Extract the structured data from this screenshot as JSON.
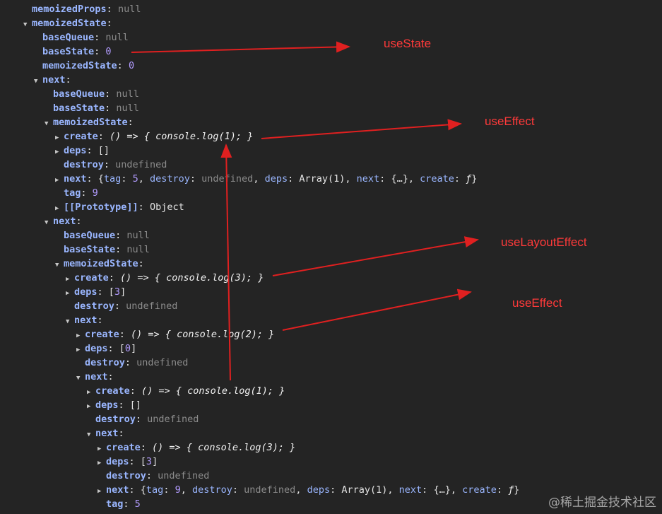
{
  "rows": [
    {
      "indent": 0,
      "arrow": "",
      "key": "memoizedProps",
      "val": "null",
      "vt": "null"
    },
    {
      "indent": 0,
      "arrow": "down",
      "key": "memoizedState",
      "val": "",
      "vt": ""
    },
    {
      "indent": 1,
      "arrow": "",
      "key": "baseQueue",
      "val": "null",
      "vt": "null"
    },
    {
      "indent": 1,
      "arrow": "",
      "key": "baseState",
      "val": "0",
      "vt": "num"
    },
    {
      "indent": 1,
      "arrow": "",
      "key": "memoizedState",
      "val": "0",
      "vt": "num"
    },
    {
      "indent": 1,
      "arrow": "down",
      "key": "next",
      "val": "",
      "vt": ""
    },
    {
      "indent": 2,
      "arrow": "",
      "key": "baseQueue",
      "val": "null",
      "vt": "null"
    },
    {
      "indent": 2,
      "arrow": "",
      "key": "baseState",
      "val": "null",
      "vt": "null"
    },
    {
      "indent": 2,
      "arrow": "down",
      "key": "memoizedState",
      "val": "",
      "vt": ""
    },
    {
      "indent": 3,
      "arrow": "right",
      "key": "create",
      "val": "() => { console.log(1); }",
      "vt": "fn"
    },
    {
      "indent": 3,
      "arrow": "right",
      "key": "deps",
      "val": "[]",
      "vt": "str"
    },
    {
      "indent": 3,
      "arrow": "",
      "key": "destroy",
      "val": "undefined",
      "vt": "null"
    },
    {
      "indent": 3,
      "arrow": "right",
      "key": "next",
      "val": "",
      "vt": "obj1"
    },
    {
      "indent": 3,
      "arrow": "",
      "key": "tag",
      "val": "9",
      "vt": "num"
    },
    {
      "indent": 3,
      "arrow": "right",
      "key": "[[Prototype]]",
      "val": "Object",
      "vt": "str"
    },
    {
      "indent": 2,
      "arrow": "down",
      "key": "next",
      "val": "",
      "vt": ""
    },
    {
      "indent": 3,
      "arrow": "",
      "key": "baseQueue",
      "val": "null",
      "vt": "null"
    },
    {
      "indent": 3,
      "arrow": "",
      "key": "baseState",
      "val": "null",
      "vt": "null"
    },
    {
      "indent": 3,
      "arrow": "down",
      "key": "memoizedState",
      "val": "",
      "vt": ""
    },
    {
      "indent": 4,
      "arrow": "right",
      "key": "create",
      "val": "() => { console.log(3); }",
      "vt": "fn"
    },
    {
      "indent": 4,
      "arrow": "right",
      "key": "deps",
      "val": "[3]",
      "vt": "arr3"
    },
    {
      "indent": 4,
      "arrow": "",
      "key": "destroy",
      "val": "undefined",
      "vt": "null"
    },
    {
      "indent": 4,
      "arrow": "down",
      "key": "next",
      "val": "",
      "vt": ""
    },
    {
      "indent": 5,
      "arrow": "right",
      "key": "create",
      "val": "() => { console.log(2); }",
      "vt": "fn"
    },
    {
      "indent": 5,
      "arrow": "right",
      "key": "deps",
      "val": "[0]",
      "vt": "arr0"
    },
    {
      "indent": 5,
      "arrow": "",
      "key": "destroy",
      "val": "undefined",
      "vt": "null"
    },
    {
      "indent": 5,
      "arrow": "down",
      "key": "next",
      "val": "",
      "vt": ""
    },
    {
      "indent": 6,
      "arrow": "right",
      "key": "create",
      "val": "() => { console.log(1); }",
      "vt": "fn"
    },
    {
      "indent": 6,
      "arrow": "right",
      "key": "deps",
      "val": "[]",
      "vt": "str"
    },
    {
      "indent": 6,
      "arrow": "",
      "key": "destroy",
      "val": "undefined",
      "vt": "null"
    },
    {
      "indent": 6,
      "arrow": "down",
      "key": "next",
      "val": "",
      "vt": ""
    },
    {
      "indent": 7,
      "arrow": "right",
      "key": "create",
      "val": "() => { console.log(3); }",
      "vt": "fn"
    },
    {
      "indent": 7,
      "arrow": "right",
      "key": "deps",
      "val": "[3]",
      "vt": "arr3"
    },
    {
      "indent": 7,
      "arrow": "",
      "key": "destroy",
      "val": "undefined",
      "vt": "null"
    },
    {
      "indent": 7,
      "arrow": "right",
      "key": "next",
      "val": "",
      "vt": "obj2"
    },
    {
      "indent": 7,
      "arrow": "",
      "key": "tag",
      "val": "5",
      "vt": "num"
    }
  ],
  "obj1": {
    "tag": "5",
    "destroy": "undefined",
    "deps": "Array(1)",
    "next": "{…}",
    "create": "ƒ"
  },
  "obj2": {
    "tag": "9",
    "destroy": "undefined",
    "deps": "Array(1)",
    "next": "{…}",
    "create": "ƒ"
  },
  "annotations": [
    {
      "label": "useState"
    },
    {
      "label": "useEffect"
    },
    {
      "label": "useLayoutEffect"
    },
    {
      "label": "useEffect"
    }
  ],
  "watermark": "@稀土掘金技术社区",
  "colors": {
    "background": "#242424",
    "key": "#9ab6ff",
    "number": "#b29cff",
    "null": "#8c8c8c",
    "annotation": "#ff3a3a"
  }
}
